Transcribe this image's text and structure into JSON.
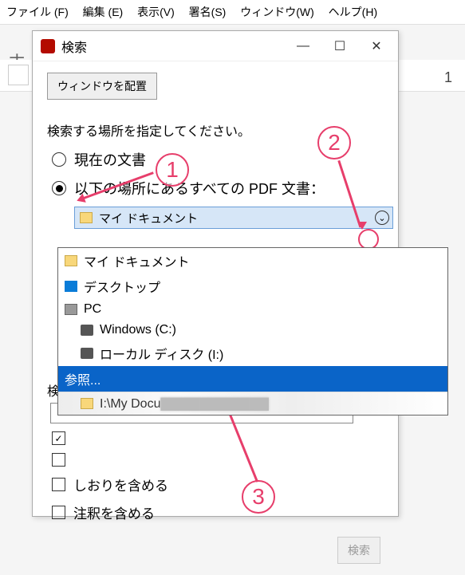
{
  "menu": {
    "file": "ファイル (F)",
    "edit": "編集 (E)",
    "view": "表示(V)",
    "sign": "署名(S)",
    "window": "ウィンドウ(W)",
    "help": "ヘルプ(H)"
  },
  "behind": {
    "home": "ホ",
    "page_num": "1"
  },
  "search_window": {
    "title": "検索",
    "arrange_btn": "ウィンドウを配置",
    "prompt": "検索する場所を指定してください。",
    "radio_current": "現在の文書",
    "radio_all": "以下の場所にあるすべての PDF 文書：",
    "combo_value": "マイ ドキュメント",
    "dropdown": {
      "mydoc": "マイ ドキュメント",
      "desktop": "デスクトップ",
      "pc": "PC",
      "drive_c": "Windows (C:)",
      "drive_i": "ローカル ディスク (I:)",
      "browse": "参照...",
      "recent_path": "I:\\My Docu"
    },
    "word_label_prefix": "検",
    "chk_exact_visible": "",
    "chk_case": "",
    "chk_bookmark": "しおりを含める",
    "chk_annot": "注釈を含める",
    "search_btn": "検索"
  },
  "annotations": {
    "n1": "1",
    "n2": "2",
    "n3": "3"
  }
}
